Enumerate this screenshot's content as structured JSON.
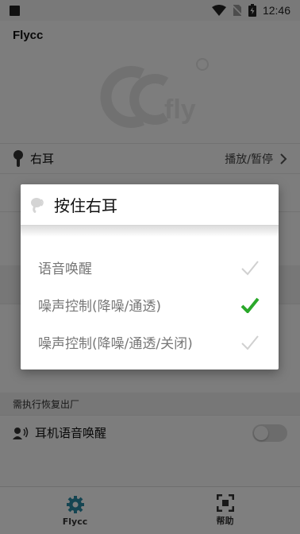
{
  "status_bar": {
    "time": "12:46"
  },
  "app": {
    "title": "Flycc"
  },
  "rows": {
    "right_ear_label": "右耳",
    "right_ear_value": "播放/暂停",
    "factory_reset_note": "需执行恢复出厂",
    "voice_wakeup_label": "耳机语音唤醒"
  },
  "bottom_nav": {
    "items": [
      {
        "label": "Flycc",
        "icon": "gear-icon",
        "color": "#2a8aa5"
      },
      {
        "label": "帮助",
        "icon": "help-icon",
        "color": "#333333"
      }
    ]
  },
  "dialog": {
    "title": "按住右耳",
    "options": [
      {
        "label": "语音唤醒",
        "selected": false
      },
      {
        "label": "噪声控制(降噪/通透)",
        "selected": true
      },
      {
        "label": "噪声控制(降噪/通透/关闭)",
        "selected": false
      }
    ],
    "check_color_selected": "#2aa82a",
    "check_color_unselected": "#d0d0d0"
  }
}
